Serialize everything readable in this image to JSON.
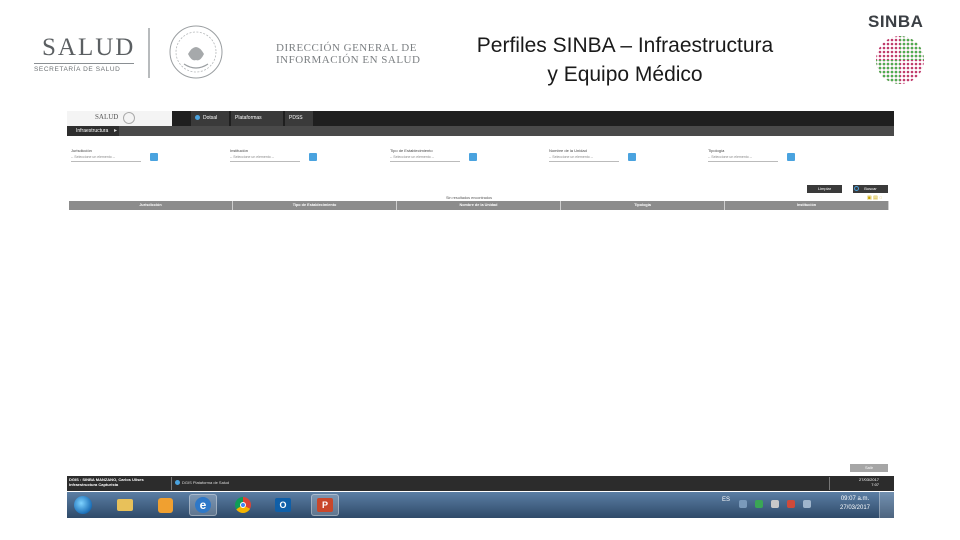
{
  "header": {
    "salud_logo": "SALUD",
    "salud_subtitle": "SECRETARÍA DE SALUD",
    "dgis_line1": "DIRECCIÓN GENERAL DE",
    "dgis_line2": "INFORMACIÓN EN SALUD",
    "title_line1": "Perfiles SINBA – Infraestructura",
    "title_line2": "y Equipo Médico",
    "sinba_logo": "SINBA"
  },
  "app": {
    "logo_text": "SALUD",
    "tabs": [
      "Dotsal",
      "Plataformas",
      "PDSS"
    ],
    "subtab": "Infraestructura",
    "filters": [
      {
        "label": "Jurisdicción",
        "value": "-- Seleccione un elemento --"
      },
      {
        "label": "Institución",
        "value": "-- Seleccione un elemento --"
      },
      {
        "label": "Tipo de Establecimiento",
        "value": "-- Seleccione un elemento --"
      },
      {
        "label": "Nombre de la Unidad",
        "value": "-- Seleccione un elemento --"
      },
      {
        "label": "Tipología",
        "value": "-- Seleccione un elemento --"
      }
    ],
    "limpiar_label": "Limpiar",
    "buscar_label": "Buscar",
    "records_label": "Sin resultados encontrados",
    "columns": [
      "Jurisdicción",
      "Tipo de Establecimiento",
      "Nombre de la Unidad",
      "Tipología",
      "Institución"
    ],
    "bottom_button": "Salir",
    "status_left_line1": "DGIS : SINBA MANZANO, Carlos Ulises",
    "status_left_line2": "Infraestructura Capturista",
    "status_mid": "DGIS Plataforma de Salud",
    "status_right_line1": "27/03/2017",
    "status_right_line2": "7:07"
  },
  "taskbar": {
    "items": [
      "start",
      "explorer",
      "media-player",
      "internet-explorer",
      "chrome",
      "outlook",
      "powerpoint"
    ],
    "tray_lang": "ES",
    "clock_time": "09:07 a.m.",
    "clock_date": "27/03/2017"
  }
}
